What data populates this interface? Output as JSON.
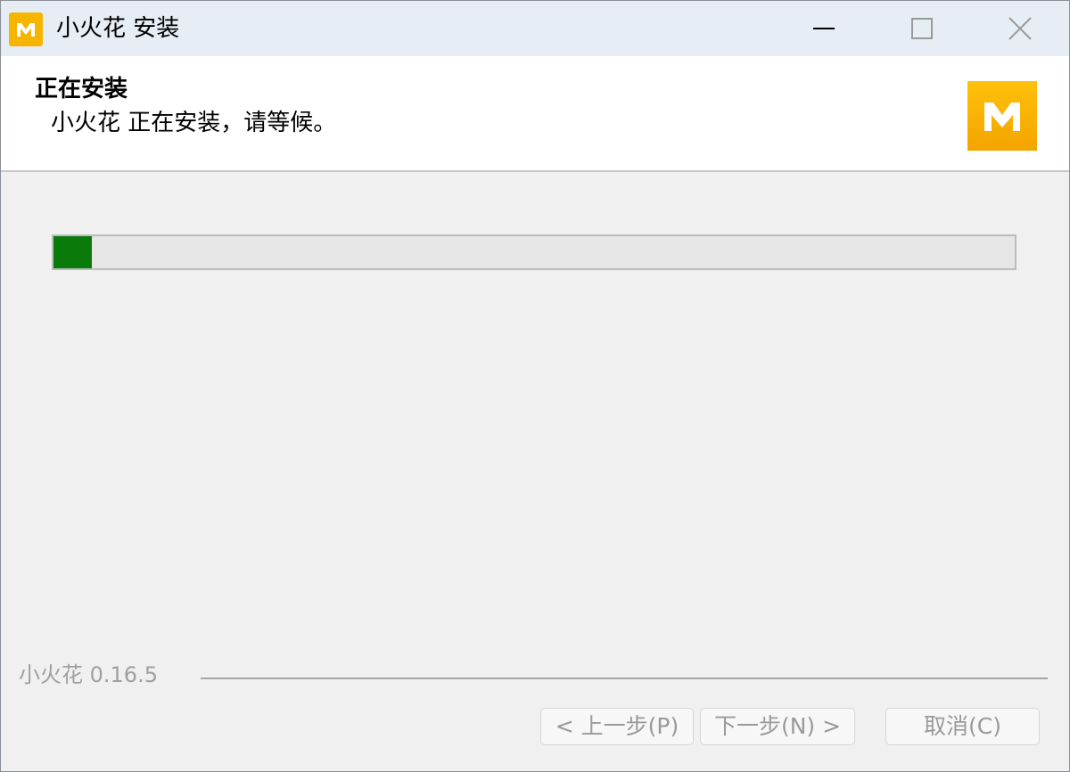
{
  "window": {
    "title": "小火花 安装",
    "app_icon": "app-logo-icon",
    "controls": [
      "minimize-icon",
      "maximize-icon",
      "close-icon"
    ]
  },
  "header": {
    "title": "正在安装",
    "subtitle": "小火花 正在安装，请等候。",
    "logo_icon": "app-logo-icon"
  },
  "progress": {
    "value": 0.04,
    "color": "#0a7a0a"
  },
  "footer": {
    "brand": "小火花 0.16.5",
    "back_label": "< 上一步(P)",
    "next_label": "下一步(N) >",
    "cancel_label": "取消(C)"
  },
  "colors": {
    "accent": "#f6b500",
    "progress_fill": "#0a7a0a"
  }
}
